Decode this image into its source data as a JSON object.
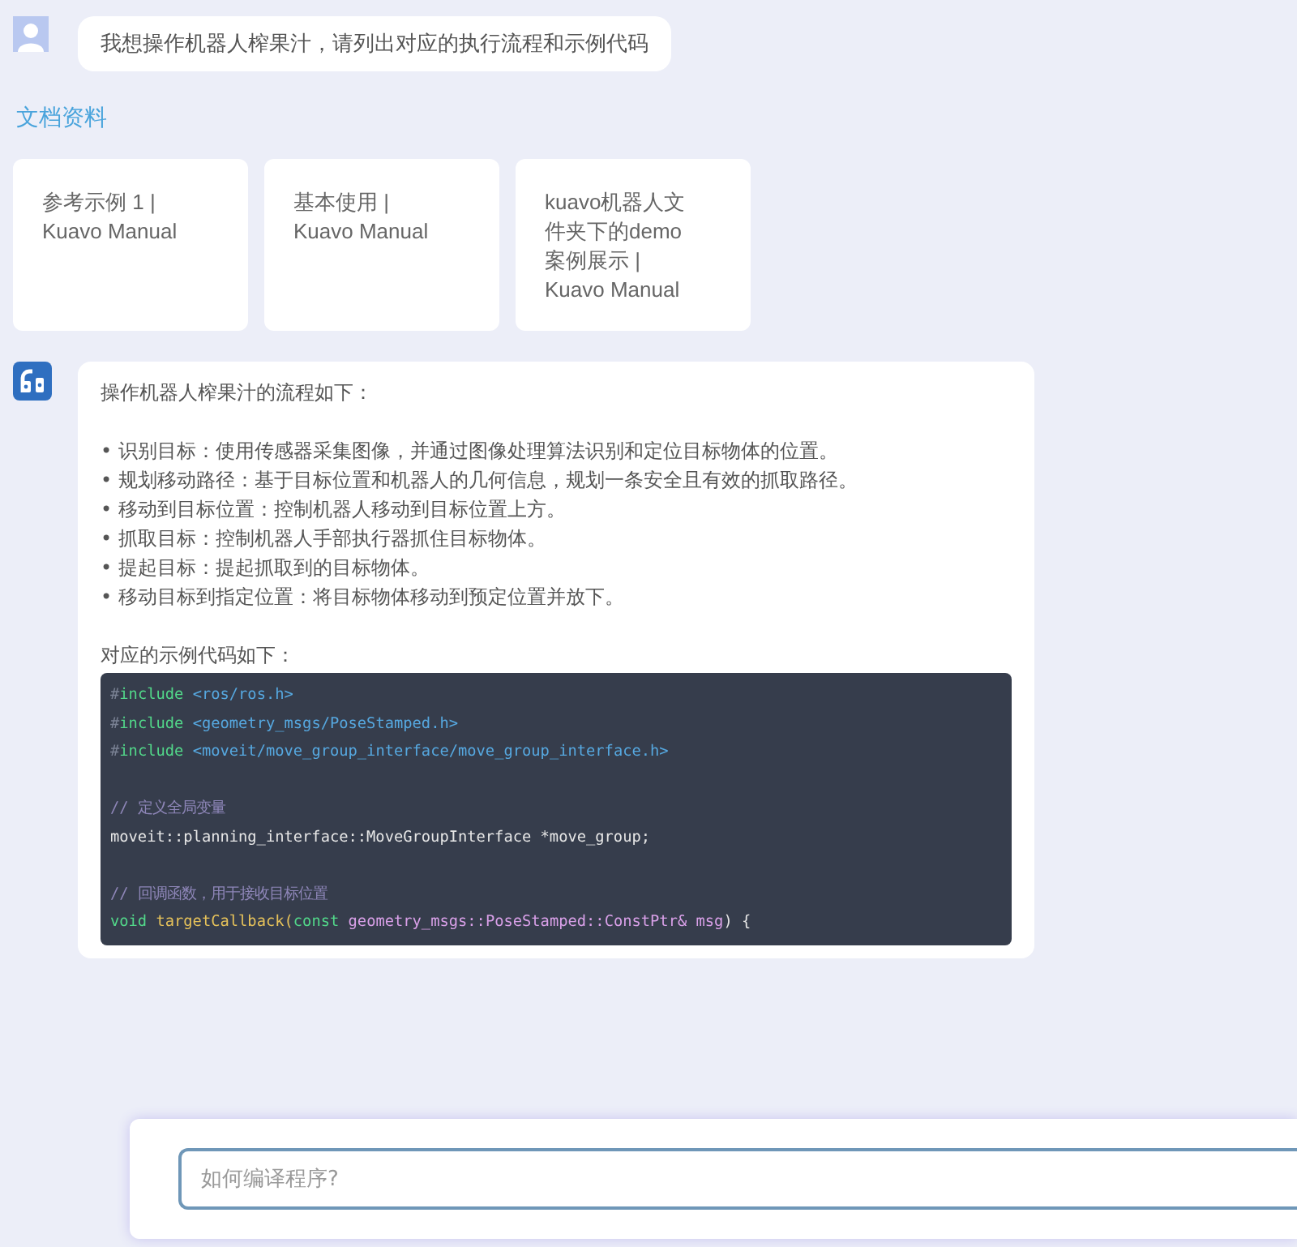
{
  "question": {
    "text": "我想操作机器人榨果汁，请列出对应的执行流程和示例代码"
  },
  "docs": {
    "title": "文档资料",
    "cards": [
      {
        "text": "参考示例 1 | Kuavo Manual"
      },
      {
        "text": "基本使用 | Kuavo Manual"
      },
      {
        "text": "kuavo机器人文件夹下的demo案例展示 | Kuavo Manual"
      }
    ]
  },
  "answer": {
    "intro": "操作机器人榨果汁的流程如下：",
    "steps": [
      "• 识别目标：使用传感器采集图像，并通过图像处理算法识别和定位目标物体的位置。",
      "• 规划移动路径：基于目标位置和机器人的几何信息，规划一条安全且有效的抓取路径。",
      "• 移动到目标位置：控制机器人移动到目标位置上方。",
      "• 抓取目标：控制机器人手部执行器抓住目标物体。",
      "• 提起目标：提起抓取到的目标物体。",
      "• 移动目标到指定位置：将目标物体移动到预定位置并放下。"
    ],
    "code_intro": "对应的示例代码如下：",
    "code_lines": [
      {
        "kind": "code",
        "tokens": [
          {
            "kind": "hash",
            "text": "#"
          },
          {
            "kind": "keyword",
            "text": "include"
          },
          {
            "kind": "string",
            "text": " <ros/ros.h>"
          }
        ]
      },
      {
        "kind": "code",
        "tokens": [
          {
            "kind": "hash",
            "text": "#"
          },
          {
            "kind": "keyword",
            "text": "include"
          },
          {
            "kind": "string",
            "text": " <geometry_msgs/PoseStamped.h>"
          }
        ]
      },
      {
        "kind": "code",
        "tokens": [
          {
            "kind": "hash",
            "text": "#"
          },
          {
            "kind": "keyword",
            "text": "include"
          },
          {
            "kind": "string",
            "text": " <moveit/move_group_interface/move_group_interface.h>"
          }
        ]
      },
      {
        "kind": "blank"
      },
      {
        "kind": "code",
        "tokens": [
          {
            "kind": "comment",
            "text": "// 定义全局变量"
          }
        ]
      },
      {
        "kind": "code",
        "tokens": [
          {
            "kind": "plain",
            "text": "moveit::planning_interface::MoveGroupInterface *move_group;"
          }
        ]
      },
      {
        "kind": "blank"
      },
      {
        "kind": "code",
        "tokens": [
          {
            "kind": "comment",
            "text": "// 回调函数，用于接收目标位置"
          }
        ]
      },
      {
        "kind": "code",
        "tokens": [
          {
            "kind": "keyword",
            "text": "void "
          },
          {
            "kind": "function",
            "text": "targetCallback("
          },
          {
            "kind": "keyword",
            "text": "const "
          },
          {
            "kind": "param",
            "text": "geometry_msgs::PoseStamped::ConstPtr& msg"
          },
          {
            "kind": "plain",
            "text": ") {"
          }
        ]
      }
    ]
  },
  "input": {
    "placeholder": "如何编译程序?"
  }
}
